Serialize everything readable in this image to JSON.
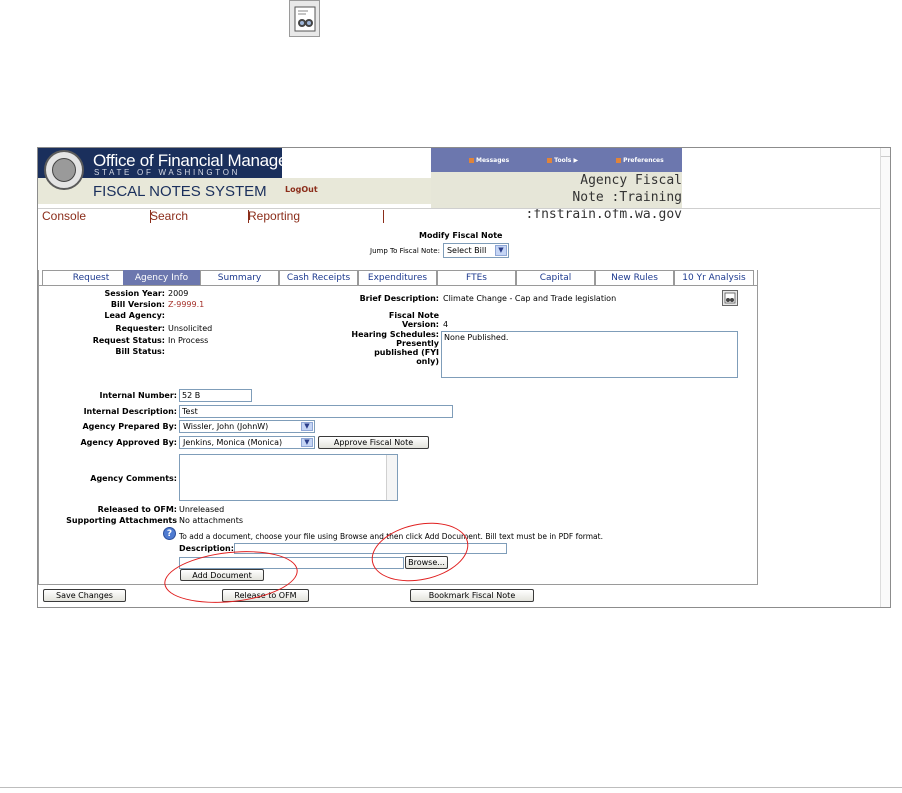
{
  "header": {
    "org_title": "Office of Financial Management",
    "org_sub": "STATE OF WASHINGTON",
    "system_title": "FISCAL NOTES SYSTEM",
    "logout": "LogOut",
    "top_nav": [
      "Messages",
      "Tools",
      "Preferences"
    ],
    "agency_title_line1": "Agency Fiscal",
    "agency_title_line2": "Note :Training :fnstrain.ofm.wa.gov"
  },
  "menu": [
    "Console",
    "Search",
    "Reporting"
  ],
  "page": {
    "title": "Modify Fiscal Note",
    "jump_label": "Jump To Fiscal Note:",
    "jump_select": "Select Bill"
  },
  "tabs": [
    "Request",
    "Agency Info",
    "Summary",
    "Cash Receipts",
    "Expenditures",
    "FTEs",
    "Capital",
    "New Rules",
    "10 Yr Analysis"
  ],
  "active_tab": "Agency Info",
  "info": {
    "session_year_label": "Session Year:",
    "session_year": "2009",
    "bill_version_label": "Bill Version:",
    "bill_version": "Z-9999.1",
    "lead_agency_label": "Lead Agency:",
    "requester_label": "Requester:",
    "requester": "Unsolicited",
    "request_status_label": "Request Status:",
    "request_status": "In Process",
    "bill_status_label": "Bill Status:",
    "brief_desc_label": "Brief Description:",
    "brief_desc": "Climate Change - Cap and Trade legislation",
    "fiscal_note_version_label1": "Fiscal Note",
    "fiscal_note_version_label2": "Version:",
    "fiscal_note_version": "4",
    "hearing_label1": "Hearing Schedules:",
    "hearing_label2": "Presently",
    "hearing_label3": "published (FYI",
    "hearing_label4": "only)",
    "hearing_value": "None Published."
  },
  "form": {
    "internal_number_label": "Internal Number:",
    "internal_number": "52 B",
    "internal_desc_label": "Internal Description:",
    "internal_desc": "Test",
    "prepared_by_label": "Agency Prepared By:",
    "prepared_by": "Wissler, John (JohnW)",
    "approved_by_label": "Agency Approved By:",
    "approved_by": "Jenkins, Monica (Monica)",
    "approve_button": "Approve Fiscal Note",
    "comments_label": "Agency Comments:",
    "comments": "",
    "released_label": "Released to OFM:",
    "released": "Unreleased",
    "attachments_label": "Supporting Attachments",
    "attachments": "No attachments",
    "upload_help": "To add a document, choose your file using Browse and then click Add Document. Bill text must be in PDF format.",
    "description_label": "Description:",
    "description": "",
    "file": "",
    "browse_button": "Browse...",
    "add_document_button": "Add Document"
  },
  "footer": {
    "save": "Save Changes",
    "release": "Release to OFM",
    "bookmark": "Bookmark Fiscal Note"
  },
  "colors": {
    "banner": "#1a2f5c",
    "tab_active": "#6c77ae",
    "menu_link": "#8b2d1a",
    "annotation": "#e02020"
  }
}
